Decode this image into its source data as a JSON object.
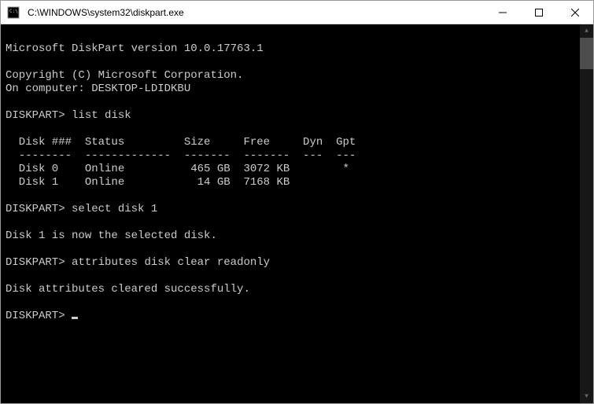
{
  "window": {
    "title": "C:\\WINDOWS\\system32\\diskpart.exe",
    "controls": {
      "minimize": "—",
      "maximize": "☐",
      "close": "✕"
    }
  },
  "console": {
    "version_line": "Microsoft DiskPart version 10.0.17763.1",
    "copyright_line": "Copyright (C) Microsoft Corporation.",
    "computer_line": "On computer: DESKTOP-LDIDKBU",
    "prompt": "DISKPART>",
    "commands": {
      "list_disk": "list disk",
      "select_disk": "select disk 1",
      "attr_clear": "attributes disk clear readonly"
    },
    "table": {
      "header": "  Disk ###  Status         Size     Free     Dyn  Gpt",
      "divider": "  --------  -------------  -------  -------  ---  ---",
      "rows": [
        "  Disk 0    Online          465 GB  3072 KB        *",
        "  Disk 1    Online           14 GB  7168 KB"
      ]
    },
    "responses": {
      "selected": "Disk 1 is now the selected disk.",
      "cleared": "Disk attributes cleared successfully."
    }
  }
}
